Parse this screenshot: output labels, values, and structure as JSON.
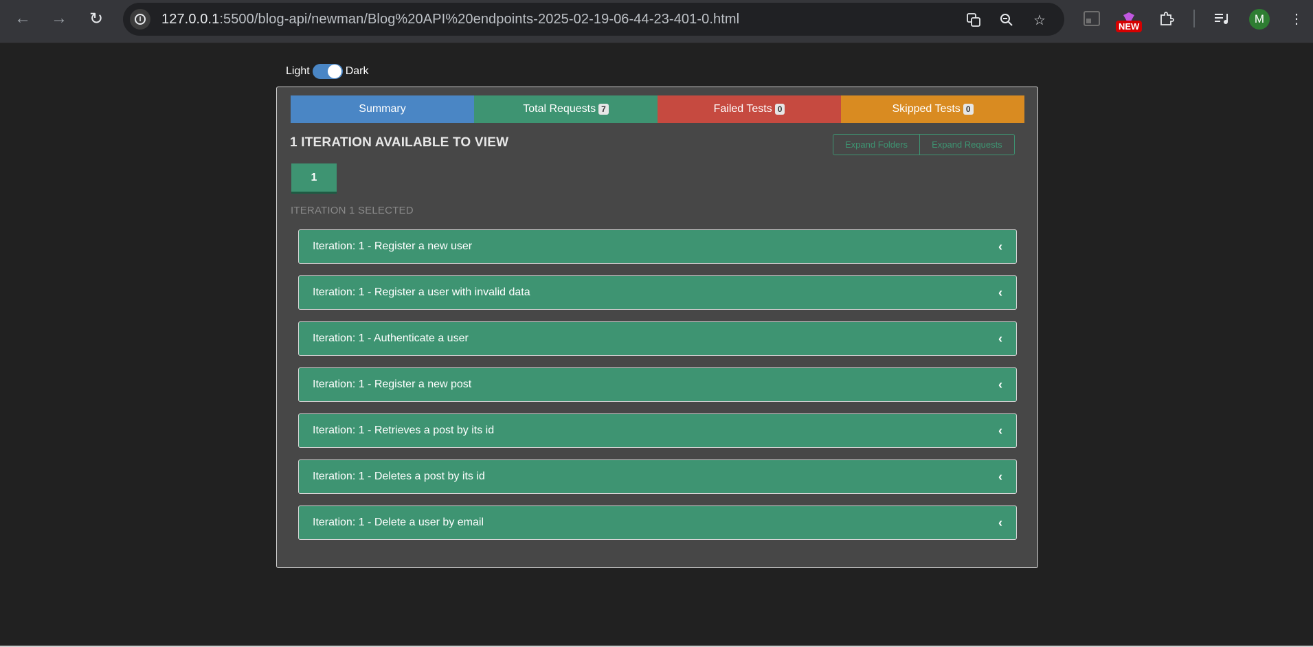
{
  "browser": {
    "url_host": "127.0.0.1",
    "url_rest": ":5500/blog-api/newman/Blog%20API%20endpoints-2025-02-19-06-44-23-401-0.html",
    "profile_initial": "M",
    "badge_new": "NEW"
  },
  "theme": {
    "light_label": "Light",
    "dark_label": "Dark",
    "mode": "dark"
  },
  "tabs": [
    {
      "label": "Summary",
      "color": "#4a86c5"
    },
    {
      "label": "Total Requests",
      "count": "7",
      "color": "#3e9472"
    },
    {
      "label": "Failed Tests",
      "count": "0",
      "color": "#c64a40"
    },
    {
      "label": "Skipped Tests",
      "count": "0",
      "color": "#d98b21"
    }
  ],
  "main": {
    "heading": "1 ITERATION AVAILABLE TO VIEW",
    "expand_folders": "Expand Folders",
    "expand_requests": "Expand Requests",
    "iteration_button": "1",
    "selected_label": "ITERATION 1 SELECTED"
  },
  "requests": [
    "Iteration: 1 - Register a new user",
    "Iteration: 1 - Register a user with invalid data",
    "Iteration: 1 - Authenticate a user",
    "Iteration: 1 - Register a new post",
    "Iteration: 1 - Retrieves a post by its id",
    "Iteration: 1 - Deletes a post by its id",
    "Iteration: 1 - Delete a user by email"
  ],
  "colors": {
    "accent_green": "#3e9472",
    "page_bg": "#212121",
    "card_bg": "#474747"
  }
}
